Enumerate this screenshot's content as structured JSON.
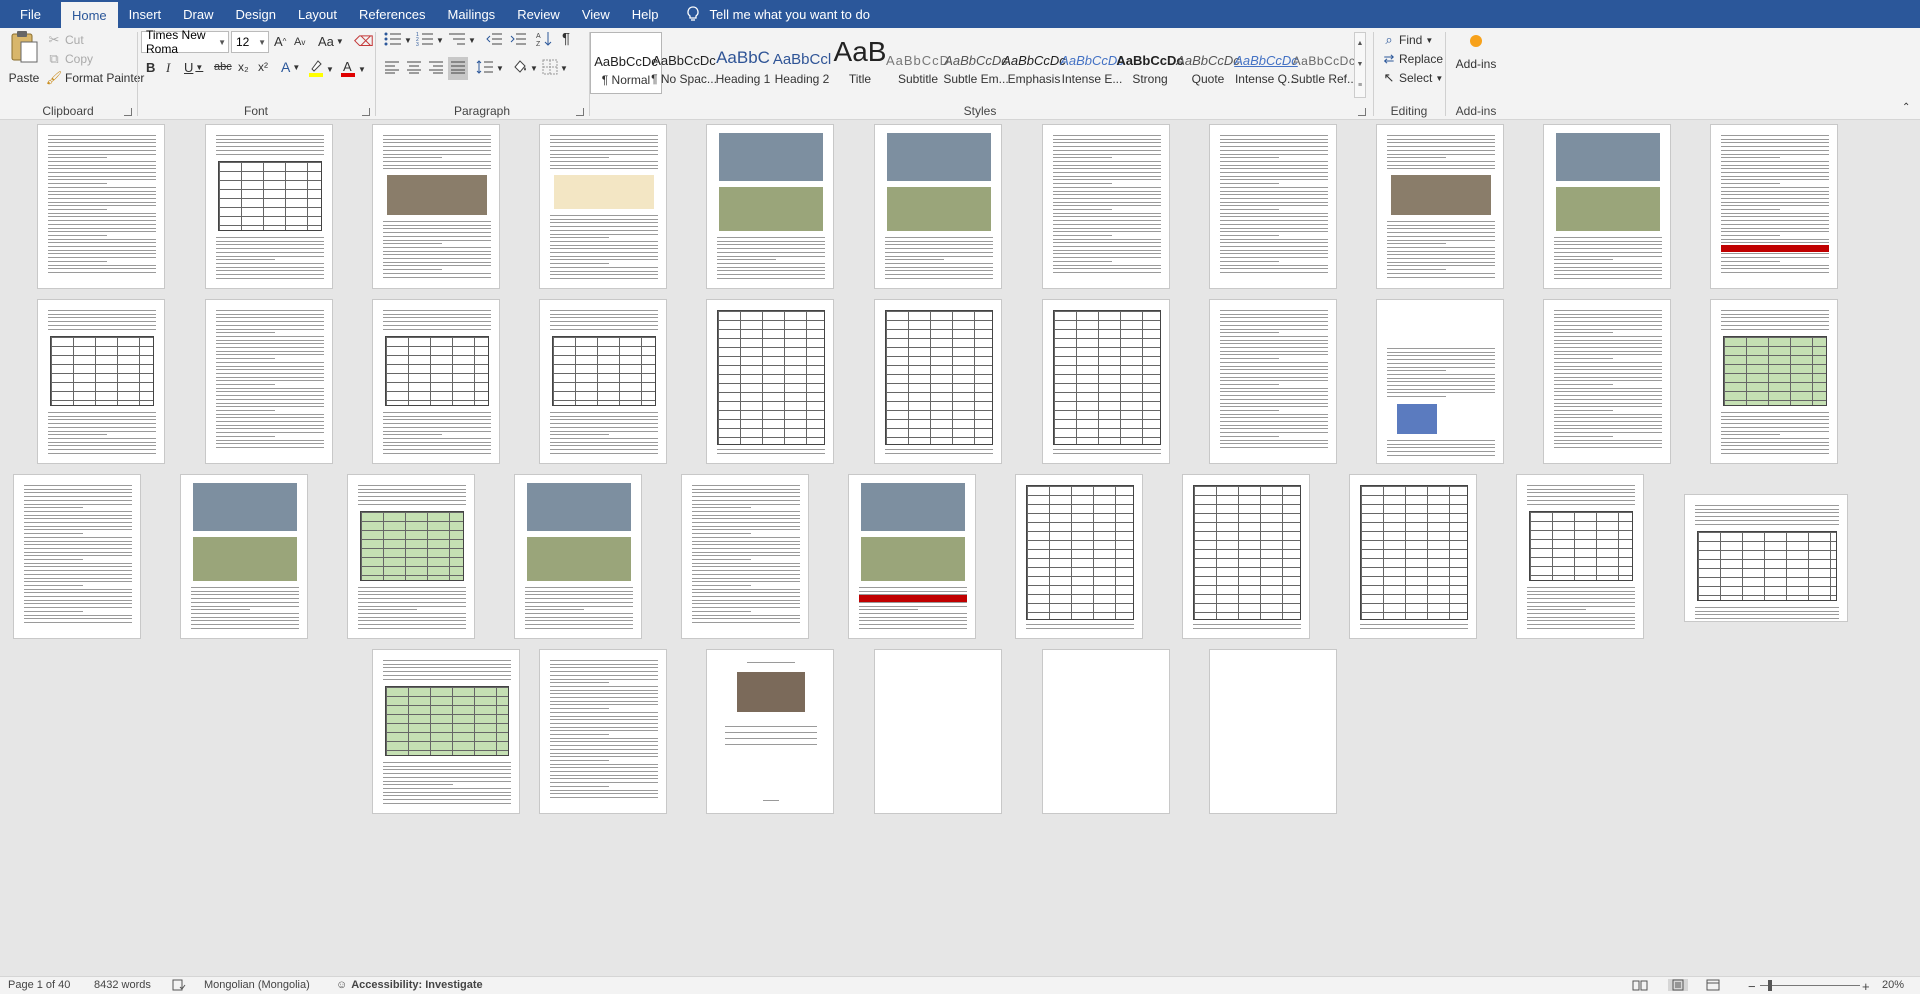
{
  "tabs": {
    "file": "File",
    "home": "Home",
    "insert": "Insert",
    "draw": "Draw",
    "design": "Design",
    "layout": "Layout",
    "references": "References",
    "mailings": "Mailings",
    "review": "Review",
    "view": "View",
    "help": "Help",
    "tell_me": "Tell me what you want to do"
  },
  "clipboard": {
    "label": "Clipboard",
    "paste": "Paste",
    "cut": "Cut",
    "copy": "Copy",
    "format_painter": "Format Painter"
  },
  "font": {
    "label": "Font",
    "name": "Times New Roma",
    "size": "12",
    "bold": "B",
    "italic": "I",
    "underline": "U",
    "strike": "abc",
    "subscript": "x₂",
    "superscript": "x²",
    "case": "Aa",
    "grow": "A",
    "shrink": "A"
  },
  "paragraph": {
    "label": "Paragraph",
    "pilcrow": "¶"
  },
  "styles": {
    "label": "Styles",
    "items": [
      {
        "preview": "AaBbCcDc",
        "name": "¶ Normal"
      },
      {
        "preview": "AaBbCcDc",
        "name": "¶ No Spac..."
      },
      {
        "preview": "AaBbC",
        "name": "Heading 1"
      },
      {
        "preview": "AaBbCcl",
        "name": "Heading 2"
      },
      {
        "preview": "AaB",
        "name": "Title"
      },
      {
        "preview": "AaBbCcD",
        "name": "Subtitle"
      },
      {
        "preview": "AaBbCcDc",
        "name": "Subtle Em..."
      },
      {
        "preview": "AaBbCcDc",
        "name": "Emphasis"
      },
      {
        "preview": "AaBbCcDc",
        "name": "Intense E..."
      },
      {
        "preview": "AaBbCcDc",
        "name": "Strong"
      },
      {
        "preview": "AaBbCcDc",
        "name": "Quote"
      },
      {
        "preview": "AaBbCcDc",
        "name": "Intense Q..."
      },
      {
        "preview": "AaBbCcDc",
        "name": "Subtle Ref..."
      }
    ]
  },
  "editing": {
    "label": "Editing",
    "find": "Find",
    "replace": "Replace",
    "select": "Select"
  },
  "addins": {
    "label": "Add-ins",
    "button": "Add-ins"
  },
  "status": {
    "page": "Page 1 of 40",
    "words": "8432 words",
    "language": "Mongolian (Mongolia)",
    "accessibility": "Accessibility: Investigate",
    "zoom": "20%"
  },
  "colors": {
    "brand": "#2b579a",
    "ribbon_bg": "#f3f3f3",
    "canvas_bg": "#e6e6e6",
    "accent_red": "#c00000",
    "heading_blue": "#2f5496",
    "table_green": "#c5e0b3"
  }
}
